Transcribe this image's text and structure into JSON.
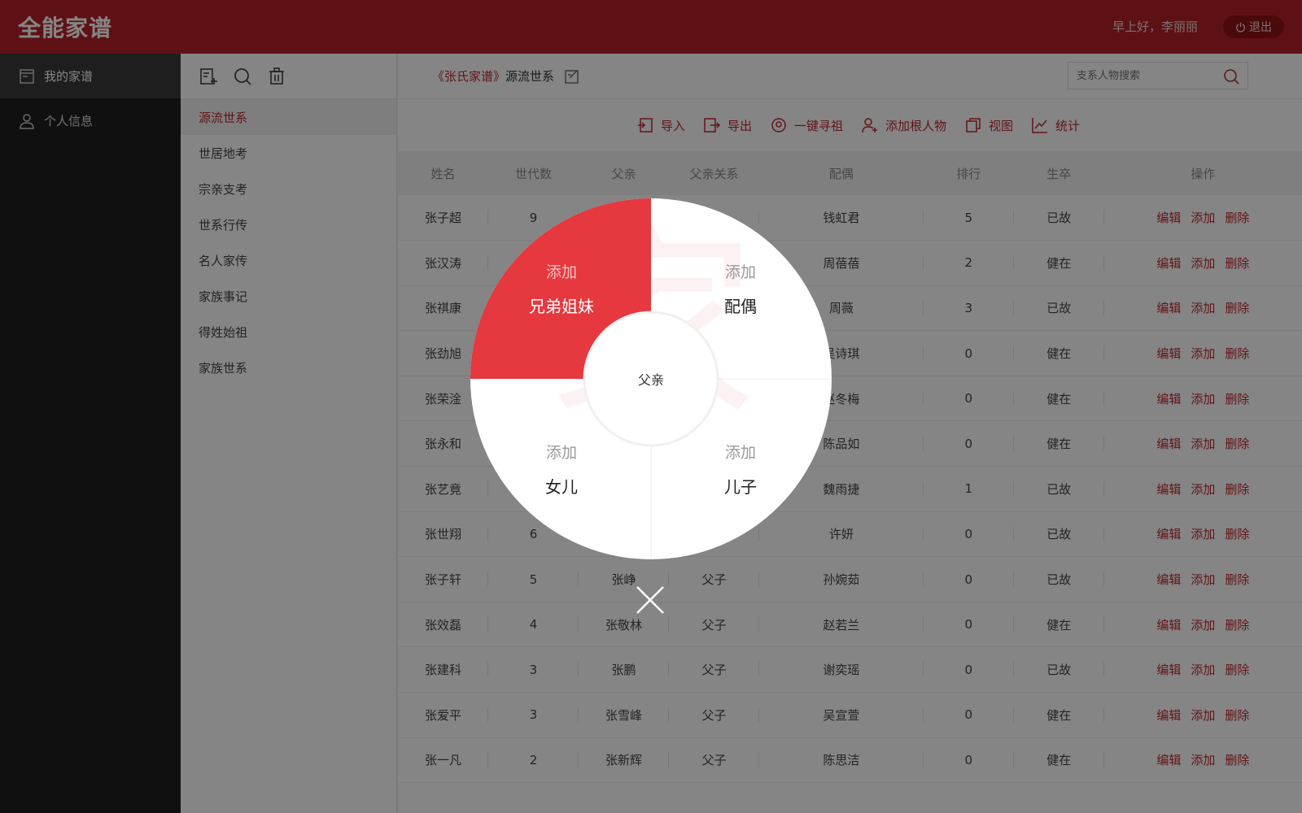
{
  "header": {
    "logo": "全能家谱",
    "greeting": "早上好，李丽丽",
    "logout_label": "退出"
  },
  "leftnav": {
    "items": [
      {
        "label": "我的家谱"
      },
      {
        "label": "个人信息"
      }
    ]
  },
  "subnav": {
    "items": [
      {
        "label": "源流世系"
      },
      {
        "label": "世居地考"
      },
      {
        "label": "宗亲支考"
      },
      {
        "label": "世系行传"
      },
      {
        "label": "名人家传"
      },
      {
        "label": "家族事记"
      },
      {
        "label": "得姓始祖"
      },
      {
        "label": "家族世系"
      }
    ]
  },
  "breadcrumb": {
    "book": "《张氏家谱》",
    "section": "源流世系"
  },
  "search": {
    "placeholder": "支系人物搜索"
  },
  "toolbar": {
    "import": "导入",
    "export": "导出",
    "find_ancestor": "一键寻祖",
    "add_root": "添加根人物",
    "view": "视图",
    "stats": "统计"
  },
  "table": {
    "headers": [
      "姓名",
      "世代数",
      "父亲",
      "父亲关系",
      "配偶",
      "排行",
      "生卒",
      "操作"
    ],
    "actions": {
      "edit": "编辑",
      "add": "添加",
      "delete": "删除"
    },
    "rows": [
      [
        "张子超",
        "9",
        "",
        "",
        "钱虹君",
        "5",
        "已故"
      ],
      [
        "张汉涛",
        "",
        "",
        "",
        "周蓓蓓",
        "2",
        "健在"
      ],
      [
        "张祺康",
        "",
        "",
        "",
        "周薇",
        "3",
        "已故"
      ],
      [
        "张劲旭",
        "",
        "",
        "",
        "吴诗琪",
        "0",
        "健在"
      ],
      [
        "张荣淦",
        "",
        "",
        "",
        "赵冬梅",
        "0",
        "健在"
      ],
      [
        "张永和",
        "",
        "",
        "",
        "陈品如",
        "0",
        "健在"
      ],
      [
        "张艺竟",
        "",
        "",
        "",
        "魏雨捷",
        "1",
        "已故"
      ],
      [
        "张世翔",
        "6",
        "",
        "",
        "许妍",
        "0",
        "已故"
      ],
      [
        "张子轩",
        "5",
        "张峥",
        "父子",
        "孙婉茹",
        "0",
        "已故"
      ],
      [
        "张效磊",
        "4",
        "张敬林",
        "父子",
        "赵若兰",
        "0",
        "健在"
      ],
      [
        "张建科",
        "3",
        "张鹏",
        "父子",
        "谢奕瑶",
        "0",
        "已故"
      ],
      [
        "张爱平",
        "3",
        "张雪峰",
        "父子",
        "吴宣萱",
        "0",
        "健在"
      ],
      [
        "张一凡",
        "2",
        "张新辉",
        "父子",
        "陈思洁",
        "0",
        "健在"
      ]
    ]
  },
  "popup": {
    "center": "父亲",
    "add_word": "添加",
    "siblings": "兄弟姐妹",
    "spouse": "配偶",
    "daughter": "女儿",
    "son": "儿子"
  },
  "colors": {
    "brand": "#b52227",
    "accent": "#e5383f",
    "link": "#c0272d"
  }
}
